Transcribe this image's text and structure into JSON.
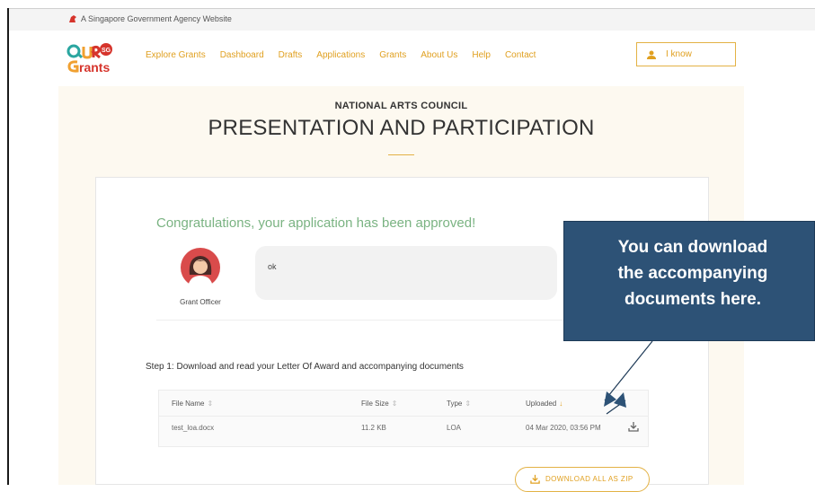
{
  "gov_banner": {
    "text": "A Singapore Government Agency Website"
  },
  "nav": {
    "items": [
      {
        "label": "Explore Grants"
      },
      {
        "label": "Dashboard"
      },
      {
        "label": "Drafts"
      },
      {
        "label": "Applications"
      },
      {
        "label": "Grants"
      },
      {
        "label": "About Us"
      },
      {
        "label": "Help"
      },
      {
        "label": "Contact"
      }
    ],
    "user_label": "I know"
  },
  "page": {
    "agency": "NATIONAL ARTS COUNCIL",
    "title": "PRESENTATION AND PARTICIPATION"
  },
  "status": {
    "message": "Congratulations, your application has been approved!",
    "officer_label": "Grant Officer",
    "officer_comment": "ok"
  },
  "step1": {
    "title": "Step 1: Download and read your Letter Of Award and accompanying documents",
    "columns": [
      "File Name",
      "File Size",
      "Type",
      "Uploaded"
    ],
    "sort_glyph": "⇕",
    "active_sort_glyph": "↓",
    "rows": [
      {
        "name": "test_loa.docx",
        "size": "11.2 KB",
        "type": "LOA",
        "uploaded": "04 Mar 2020, 03:56 PM"
      }
    ],
    "download_all_label": "DOWNLOAD ALL AS ZIP"
  },
  "annotation": {
    "line1": "You can download",
    "line2": "the accompanying",
    "line3": "documents here."
  },
  "colors": {
    "accent": "#e0a020",
    "success": "#7ab382",
    "callout_bg": "#2d5276",
    "content_bg": "#fdf9f0"
  },
  "icons": {
    "gov": "lion-head-icon",
    "user": "user-icon",
    "download": "download-icon"
  }
}
